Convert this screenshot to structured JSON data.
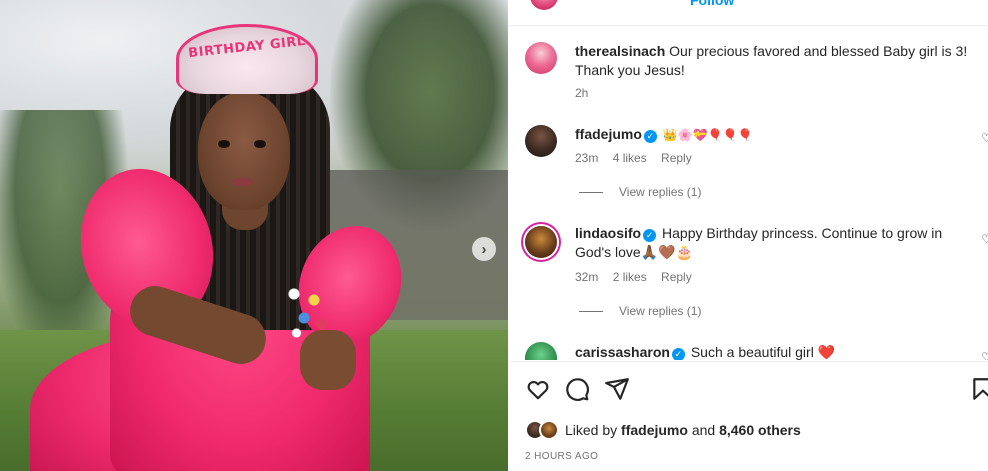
{
  "post": {
    "follow_label": "Follow",
    "headband_text": "BIRTHDAY GIRL",
    "next_arrow": "›"
  },
  "caption": {
    "username": "therealsinach",
    "text": "Our precious favored and blessed Baby girl is 3! Thank you Jesus!",
    "time": "2h"
  },
  "comments": [
    {
      "username": "ffadejumo",
      "verified": true,
      "text": "👑🌸💝🎈🎈🎈",
      "time": "23m",
      "likes": "4 likes",
      "reply": "Reply",
      "view_replies": "View replies (1)"
    },
    {
      "username": "lindaosifo",
      "verified": true,
      "text": "Happy Birthday princess. Continue to grow in God's love🙏🏾🤎🎂",
      "time": "32m",
      "likes": "2 likes",
      "reply": "Reply",
      "view_replies": "View replies (1)"
    },
    {
      "username": "carissasharon",
      "verified": true,
      "text": "Such a beautiful girl ❤️"
    }
  ],
  "likes": {
    "prefix": "Liked by",
    "user": "ffadejumo",
    "joiner": "and",
    "count": "8,460 others"
  },
  "timestamp": "2 HOURS AGO",
  "icons": {
    "like": "heart-icon",
    "comment": "comment-icon",
    "share": "share-icon",
    "save": "bookmark-icon"
  },
  "colors": {
    "accent": "#0095f6",
    "muted": "#737373",
    "text": "#262626"
  }
}
